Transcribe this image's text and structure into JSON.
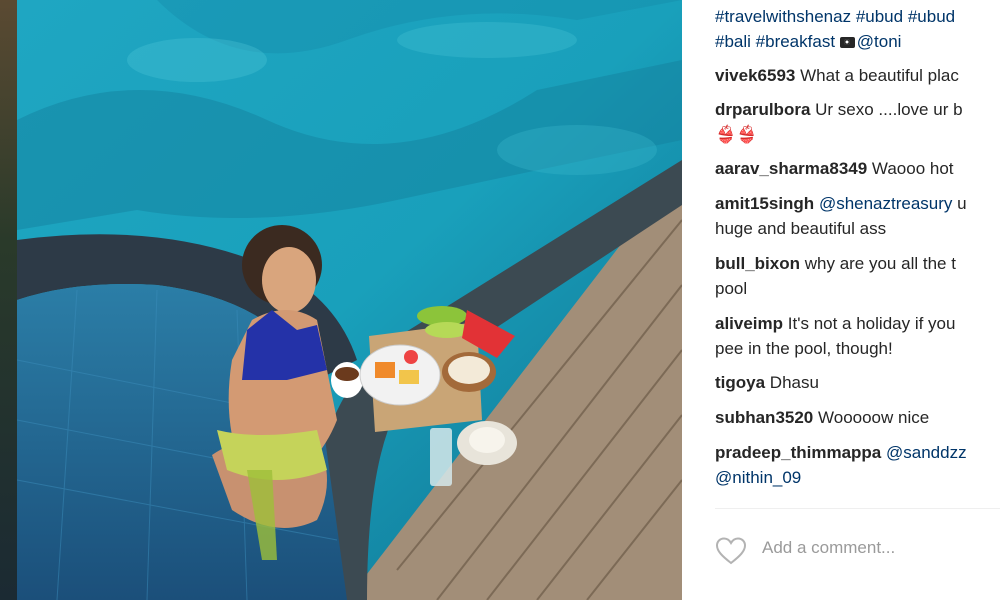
{
  "caption": {
    "line1_tags": [
      "#travelwithshenaz",
      "#ubud",
      "#ubud"
    ],
    "line2_tags": [
      "#bali",
      "#breakfast"
    ],
    "credit_icon": "camera-icon",
    "credit": "@toni"
  },
  "comments": [
    {
      "user": "vivek6593",
      "lines": [
        "What a beautiful plac"
      ]
    },
    {
      "user": "drparulbora",
      "lines": [
        "Ur sexo ....love ur b",
        "👙👙"
      ]
    },
    {
      "user": "aarav_sharma8349",
      "lines": [
        "Waooo hot"
      ]
    },
    {
      "user": "amit15singh",
      "mention": "@shenaztreasury",
      "lines": [
        "u",
        "huge and beautiful ass"
      ]
    },
    {
      "user": "bull_bixon",
      "lines": [
        "why are you all the t",
        "pool"
      ]
    },
    {
      "user": "aliveimp",
      "lines": [
        "It's not a holiday if you",
        "pee in the pool, though!"
      ]
    },
    {
      "user": "tigoya",
      "lines": [
        "Dhasu"
      ]
    },
    {
      "user": "subhan3520",
      "lines": [
        "Wooooow nice"
      ]
    },
    {
      "user": "pradeep_thimmappa",
      "mention": "@sanddzz",
      "mention2": "@nithin_09"
    }
  ],
  "add_comment": {
    "placeholder": "Add a comment...",
    "like_icon": "heart-icon"
  },
  "colors": {
    "tag": "#003569",
    "text": "#262626",
    "placeholder": "#9a9a9a",
    "pool": "#1a9fb5"
  }
}
